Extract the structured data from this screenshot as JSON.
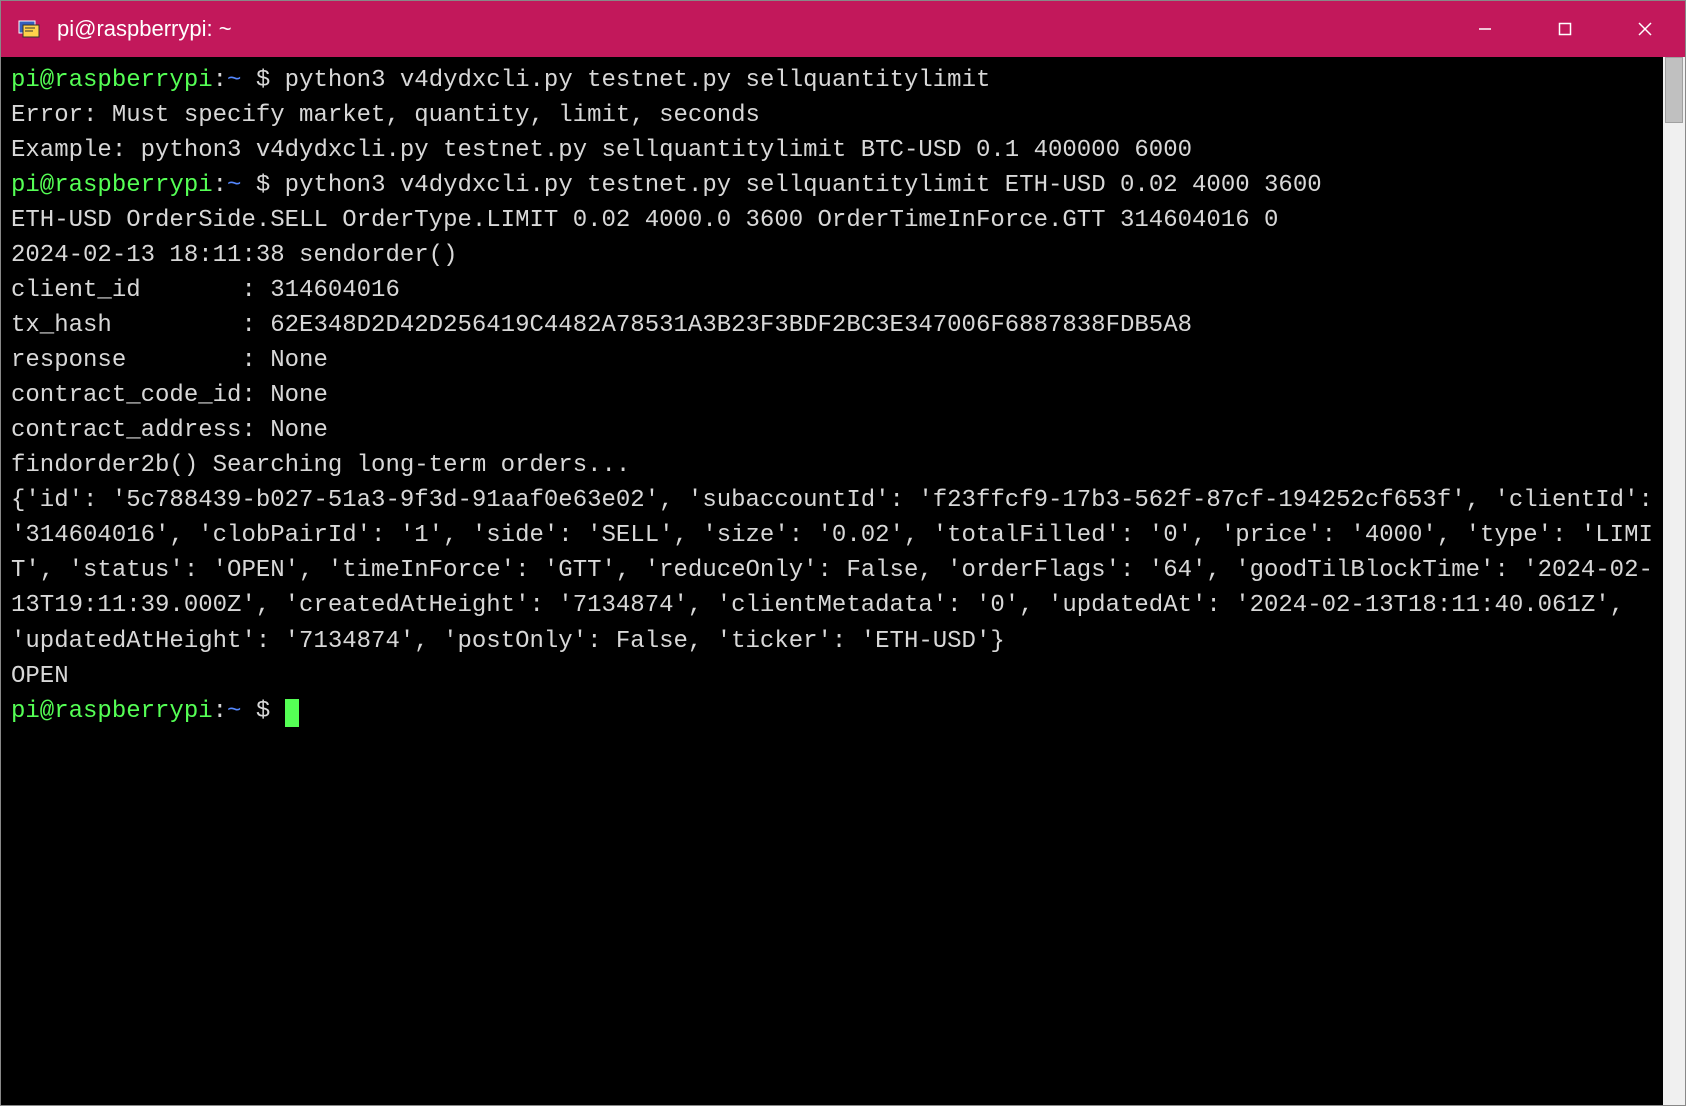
{
  "window": {
    "title": "pi@raspberrypi: ~"
  },
  "prompt": {
    "user_host": "pi@raspberrypi",
    "colon": ":",
    "path": "~",
    "dollar": " $ "
  },
  "lines": {
    "cmd1": "python3 v4dydxcli.py testnet.py sellquantitylimit",
    "out1": "Error: Must specify market, quantity, limit, seconds",
    "out2": "Example: python3 v4dydxcli.py testnet.py sellquantitylimit BTC-USD 0.1 400000 6000",
    "cmd2": "python3 v4dydxcli.py testnet.py sellquantitylimit ETH-USD 0.02 4000 3600",
    "out3": "ETH-USD OrderSide.SELL OrderType.LIMIT 0.02 4000.0 3600 OrderTimeInForce.GTT 314604016 0",
    "out4": "2024-02-13 18:11:38 sendorder()",
    "out5": "client_id       : 314604016",
    "out6": "tx_hash         : 62E348D2D42D256419C4482A78531A3B23F3BDF2BC3E347006F6887838FDB5A8",
    "out7": "response        : None",
    "out8": "contract_code_id: None",
    "out9": "contract_address: None",
    "out10": "findorder2b() Searching long-term orders...",
    "out11": "{'id': '5c788439-b027-51a3-9f3d-91aaf0e63e02', 'subaccountId': 'f23ffcf9-17b3-562f-87cf-194252cf653f', 'clientId': '314604016', 'clobPairId': '1', 'side': 'SELL', 'size': '0.02', 'totalFilled': '0', 'price': '4000', 'type': 'LIMIT', 'status': 'OPEN', 'timeInForce': 'GTT', 'reduceOnly': False, 'orderFlags': '64', 'goodTilBlockTime': '2024-02-13T19:11:39.000Z', 'createdAtHeight': '7134874', 'clientMetadata': '0', 'updatedAt': '2024-02-13T18:11:40.061Z', 'updatedAtHeight': '7134874', 'postOnly': False, 'ticker': 'ETH-USD'}",
    "out12": "OPEN"
  }
}
